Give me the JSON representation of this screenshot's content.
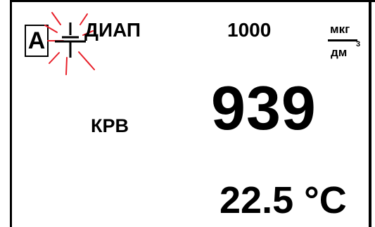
{
  "display": {
    "mode_indicator": "A",
    "range_label": "ДИАП",
    "range_value": "1000",
    "unit_numerator": "мкг",
    "unit_denominator": "дм",
    "unit_exponent": "3",
    "parameter_label": "КРВ",
    "main_value": "939",
    "temperature": "22.5 °С"
  },
  "icons": {
    "status_icon": "blinking-connector-icon"
  },
  "colors": {
    "background": "#ffffff",
    "text": "#000000",
    "blink_rays": "#e8202a"
  }
}
